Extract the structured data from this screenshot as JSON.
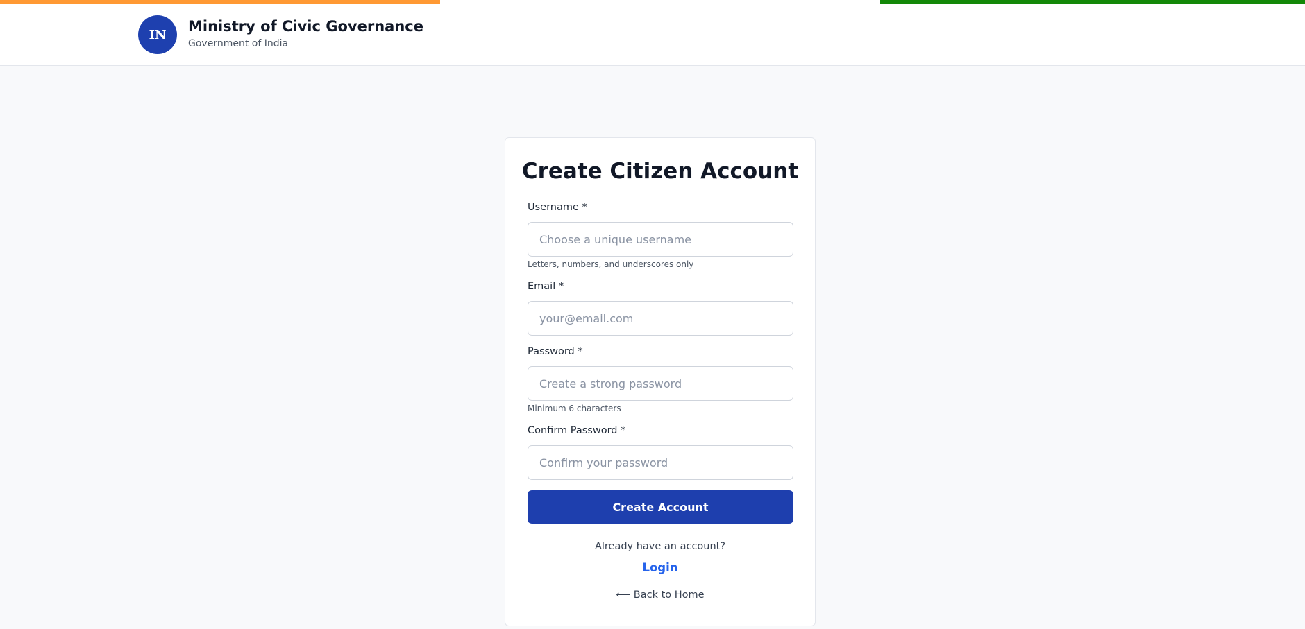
{
  "header": {
    "emblem_text": "IN",
    "ministry_name": "Ministry of Civic Governance",
    "subtitle": "Government of India"
  },
  "colors": {
    "saffron": "#ff9933",
    "green": "#138808",
    "primary": "#1e3fae",
    "link": "#2563eb"
  },
  "form": {
    "title": "Create Citizen Account",
    "username": {
      "label": "Username *",
      "placeholder": "Choose a unique username",
      "hint": "Letters, numbers, and underscores only"
    },
    "email": {
      "label": "Email *",
      "placeholder": "your@email.com"
    },
    "password": {
      "label": "Password *",
      "placeholder": "Create a strong password",
      "hint": "Minimum 6 characters"
    },
    "confirm_password": {
      "label": "Confirm Password *",
      "placeholder": "Confirm your password"
    },
    "submit_label": "Create Account",
    "already_text": "Already have an account?",
    "login_label": "Login",
    "back_home_label": "⟵ Back to Home"
  }
}
